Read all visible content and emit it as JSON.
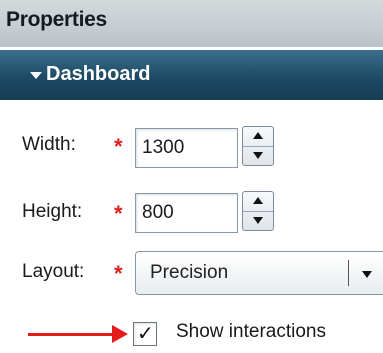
{
  "header": {
    "title": "Properties"
  },
  "section": {
    "title": "Dashboard",
    "expand_icon": "caret-down"
  },
  "fields": {
    "width": {
      "label": "Width:",
      "required_marker": "*",
      "value": "1300"
    },
    "height": {
      "label": "Height:",
      "required_marker": "*",
      "value": "800"
    },
    "layout": {
      "label": "Layout:",
      "required_marker": "*",
      "selected": "Precision"
    }
  },
  "show_interactions": {
    "label": "Show interactions",
    "checked": true,
    "check_glyph": "✓"
  },
  "colors": {
    "section_bar": "#1e4a64",
    "required": "#e02020",
    "annotation_arrow": "#e51b1b"
  }
}
